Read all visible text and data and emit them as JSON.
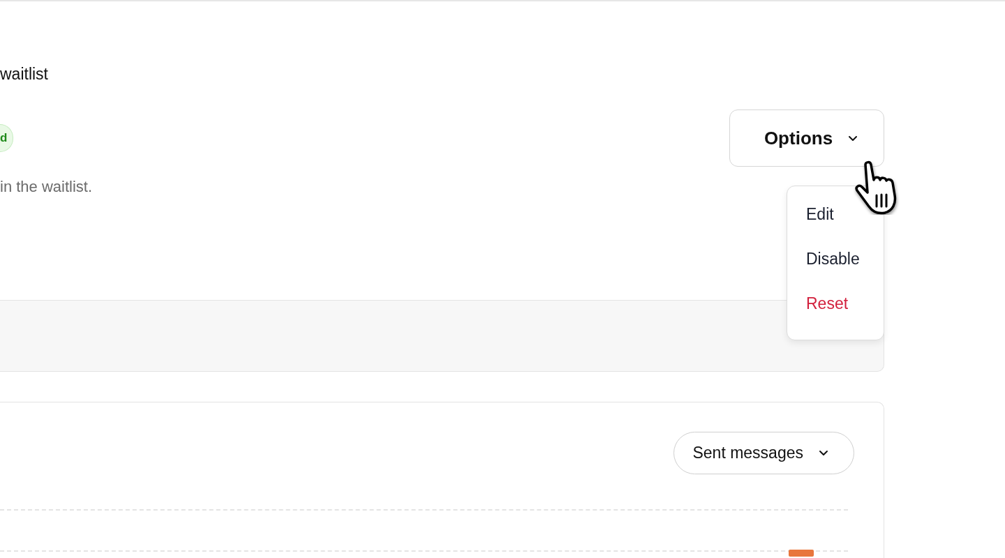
{
  "section": {
    "title": "waitlist",
    "status_badge": "d",
    "description": "in the waitlist."
  },
  "options_button": {
    "label": "Options",
    "expanded": true
  },
  "options_menu": [
    {
      "label": "Edit",
      "kind": "normal"
    },
    {
      "label": "Disable",
      "kind": "normal"
    },
    {
      "label": "Reset",
      "kind": "danger"
    }
  ],
  "messages_card": {
    "filter_button": "Sent messages"
  }
}
